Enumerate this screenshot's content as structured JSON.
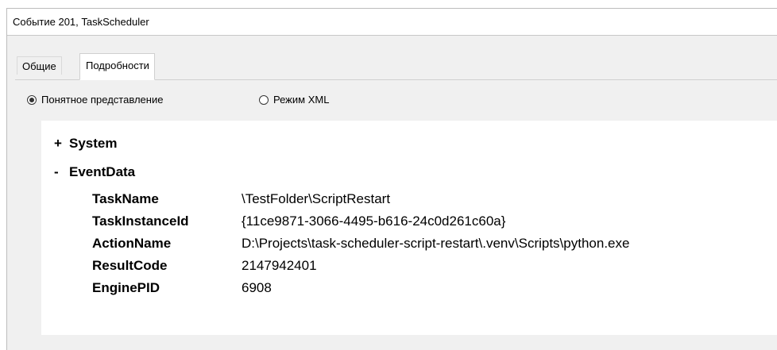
{
  "window": {
    "title": "Событие 201, TaskScheduler"
  },
  "tabs": [
    {
      "label": "Общие",
      "active": false
    },
    {
      "label": "Подробности",
      "active": true
    }
  ],
  "view_mode": {
    "options": [
      {
        "label": "Понятное представление",
        "selected": true
      },
      {
        "label": "Режим XML",
        "selected": false
      }
    ]
  },
  "details": {
    "system": {
      "toggle": "+",
      "label": "System"
    },
    "event_data": {
      "toggle": "-",
      "label": "EventData",
      "fields": [
        {
          "key": "TaskName",
          "value": "\\TestFolder\\ScriptRestart"
        },
        {
          "key": "TaskInstanceId",
          "value": "{11ce9871-3066-4495-b616-24c0d261c60a}"
        },
        {
          "key": "ActionName",
          "value": "D:\\Projects\\task-scheduler-script-restart\\.venv\\Scripts\\python.exe"
        },
        {
          "key": "ResultCode",
          "value": "2147942401"
        },
        {
          "key": "EnginePID",
          "value": "6908"
        }
      ]
    }
  }
}
